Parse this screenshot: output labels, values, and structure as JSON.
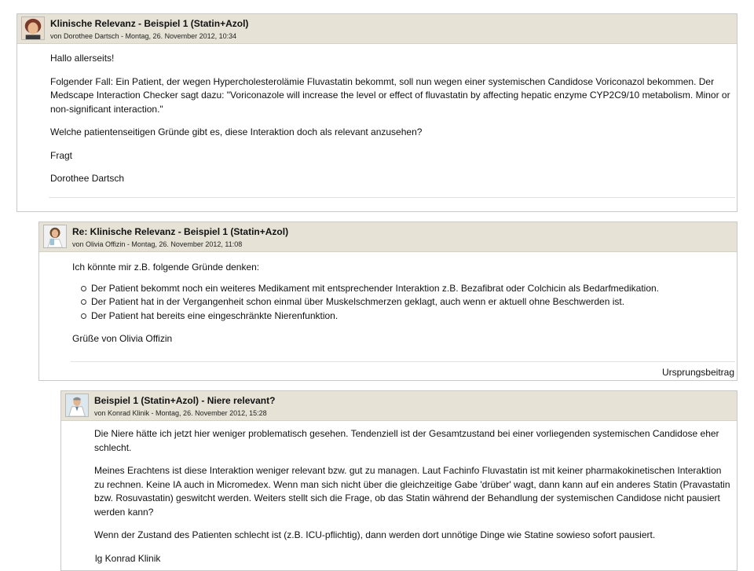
{
  "posts": [
    {
      "title": "Klinische Relevanz - Beispiel 1 (Statin+Azol)",
      "meta": "von Dorothee Dartsch - Montag, 26. November 2012, 10:34",
      "greeting": "Hallo allerseits!",
      "para1": "Folgender Fall: Ein Patient, der wegen Hypercholesterolämie Fluvastatin bekommt, soll nun wegen einer systemischen Candidose Voriconazol bekommen. Der Medscape Interaction Checker sagt dazu: \"Voriconazole will increase the level or effect of fluvastatin by affecting hepatic enzyme CYP2C9/10 metabolism. Minor or non-significant interaction.\"",
      "para2": "Welche patientenseitigen Gründe gibt es, diese Interaktion doch als relevant anzusehen?",
      "para3": "Fragt",
      "signature": "Dorothee Dartsch"
    },
    {
      "title": "Re: Klinische Relevanz - Beispiel 1 (Statin+Azol)",
      "meta": "von Olivia Offizin - Montag, 26. November 2012, 11:08",
      "intro": "Ich könnte mir z.B. folgende Gründe denken:",
      "items": [
        "Der Patient bekommt noch ein weiteres Medikament mit entsprechender Interaktion z.B. Bezafibrat oder Colchicin als Bedarfmedikation.",
        "Der Patient hat in der Vergangenheit schon einmal über Muskelschmerzen geklagt, auch wenn er aktuell ohne Beschwerden ist.",
        "Der Patient hat bereits eine eingeschränkte Nierenfunktion."
      ],
      "signature": "Grüße von Olivia Offizin",
      "link": "Ursprungsbeitrag"
    },
    {
      "title": "Beispiel 1 (Statin+Azol) - Niere relevant?",
      "meta": "von Konrad Klinik - Montag, 26. November 2012, 15:28",
      "para1": "Die Niere hätte ich jetzt hier weniger problematisch gesehen. Tendenziell ist der Gesamtzustand bei einer vorliegenden systemischen Candidose eher schlecht.",
      "para2": "Meines Erachtens ist diese Interaktion weniger relevant bzw. gut zu managen. Laut Fachinfo Fluvastatin ist mit keiner pharmakokinetischen Interaktion zu rechnen. Keine IA auch in Micromedex. Wenn man sich nicht über die gleichzeitige Gabe 'drüber' wagt, dann kann auf ein anderes Statin (Pravastatin bzw. Rosuvastatin) geswitcht werden. Weiters stellt sich die Frage, ob das Statin während der Behandlung der systemischen Candidose nicht pausiert werden kann?",
      "para3": "Wenn der Zustand des Patienten schlecht ist (z.B. ICU-pflichtig), dann werden dort unnötige Dinge wie Statine sowieso sofort pausiert.",
      "signature": "lg Konrad Klinik"
    }
  ]
}
